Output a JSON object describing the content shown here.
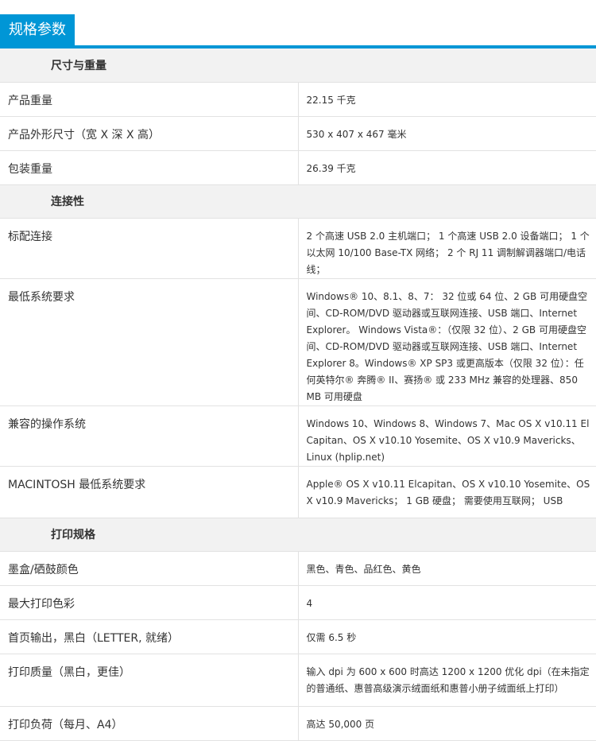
{
  "header": {
    "title": "规格参数"
  },
  "sections": [
    {
      "title": "尺寸与重量",
      "rows": [
        {
          "label": "产品重量",
          "value": "22.15 千克"
        },
        {
          "label": "产品外形尺寸（宽 X 深 X 高）",
          "value": "530 x 407 x 467 毫米"
        },
        {
          "label": "包装重量",
          "value": "26.39 千克"
        }
      ]
    },
    {
      "title": "连接性",
      "rows": [
        {
          "label": "标配连接",
          "value": "2 个高速 USB 2.0 主机端口； 1 个高速 USB 2.0 设备端口； 1 个以太网 10/100 Base-TX 网络； 2 个 RJ 11 调制解调器端口/电话 线；"
        },
        {
          "label": "最低系统要求",
          "value": "Windows® 10、8.1、8、7： 32 位或 64 位、2 GB 可用硬盘空间、CD-ROM/DVD 驱动器或互联网连接、USB 端口、Internet Explorer。 Windows Vista®：（仅限 32 位）、2 GB 可用硬盘空间、CD-ROM/DVD 驱动器或互联网连接、USB 端口、Internet Explorer 8。Windows® XP SP3 或更高版本（仅限 32 位）：任何英特尔® 奔腾® II、赛扬® 或 233 MHz 兼容的处理器、850 MB 可用硬盘"
        },
        {
          "label": "兼容的操作系统",
          "value": "Windows 10、Windows 8、Windows 7、Mac OS X v10.11 El Capitan、OS X v10.10 Yosemite、OS X v10.9 Mavericks、Linux (hplip.net)"
        },
        {
          "label": "MACINTOSH 最低系统要求",
          "value": "Apple® OS X v10.11 Elcapitan、OS X v10.10 Yosemite、OS X v10.9 Mavericks； 1 GB 硬盘； 需要使用互联网； USB"
        }
      ]
    },
    {
      "title": "打印规格",
      "rows": [
        {
          "label": "墨盒/硒鼓颜色",
          "value": "黑色、青色、品红色、黄色"
        },
        {
          "label": "最大打印色彩",
          "value": "4"
        },
        {
          "label": "首页输出，黑白（LETTER, 就绪）",
          "value": "仅需 6.5 秒"
        },
        {
          "label": "打印质量（黑白，更佳）",
          "value": "输入 dpi 为 600 x 600 时高达 1200 x 1200 优化 dpi（在未指定的普通纸、惠普高级演示绒面纸和惠普小册子绒面纸上打印）"
        },
        {
          "label": "打印负荷（每月、A4）",
          "value": "高达 50,000 页"
        }
      ]
    }
  ]
}
